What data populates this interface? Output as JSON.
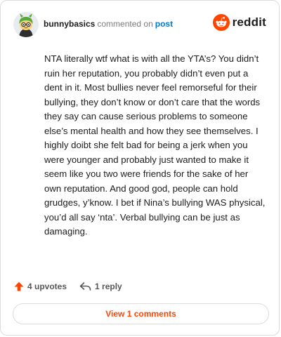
{
  "header": {
    "author": "bunnybasics",
    "action_text": "commented on",
    "post_link_label": "post",
    "brand_wordmark": "reddit"
  },
  "comment": {
    "body": "NTA literally wtf what is with all the YTA’s? You didn’t ruin her reputation, you probably didn’t even put a dent in it. Most bullies never feel remorseful for their bullying, they don’t know or don’t care that the words they say can cause serious problems to someone else’s mental health and how they see themselves. I highly doibt she felt bad for being a jerk when you were younger and probably just wanted to make it seem like you two were friends for the sake of her own reputation. And good god, people can hold grudges, y’know. I bet if Nina’s bullying WAS physical, you’d all say ‘nta’. Verbal bullying can be just as damaging."
  },
  "actions": {
    "upvotes_label": "4 upvotes",
    "reply_label": "1 reply"
  },
  "footer": {
    "view_comments_label": "View 1 comments"
  },
  "colors": {
    "brand_orange": "#ff4500",
    "link_blue": "#0079d3",
    "muted_text": "#7c7c7c"
  },
  "icons": {
    "avatar": "snoo-avatar",
    "brand": "reddit-snoo-icon",
    "upvote": "upvote-arrow-icon",
    "reply": "reply-arrow-icon"
  }
}
